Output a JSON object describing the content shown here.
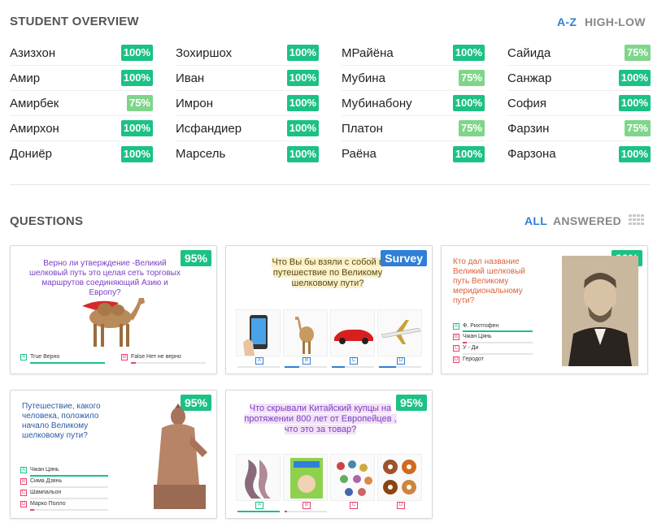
{
  "overview": {
    "title": "STUDENT OVERVIEW",
    "sort_az": "A-Z",
    "sort_highlow": "HIGH-LOW",
    "columns": [
      [
        {
          "name": "Азизхон",
          "score": "100%"
        },
        {
          "name": "Амир",
          "score": "100%"
        },
        {
          "name": "Амирбек",
          "score": "75%"
        },
        {
          "name": "Амирхон",
          "score": "100%"
        },
        {
          "name": "Дониёр",
          "score": "100%"
        }
      ],
      [
        {
          "name": "Зохиршох",
          "score": "100%"
        },
        {
          "name": "Иван",
          "score": "100%"
        },
        {
          "name": "Имрон",
          "score": "100%"
        },
        {
          "name": "Исфандиер",
          "score": "100%"
        },
        {
          "name": "Марсель",
          "score": "100%"
        }
      ],
      [
        {
          "name": "МРайёна",
          "score": "100%"
        },
        {
          "name": "Мубина",
          "score": "75%"
        },
        {
          "name": "Мубинабону",
          "score": "100%"
        },
        {
          "name": "Платон",
          "score": "75%"
        },
        {
          "name": "Раёна",
          "score": "100%"
        }
      ],
      [
        {
          "name": "Сайида",
          "score": "75%"
        },
        {
          "name": "Санжар",
          "score": "100%"
        },
        {
          "name": "София",
          "score": "100%"
        },
        {
          "name": "Фарзин",
          "score": "75%"
        },
        {
          "name": "Фарзона",
          "score": "100%"
        }
      ]
    ]
  },
  "questions": {
    "title": "QUESTIONS",
    "filter_all": "ALL",
    "filter_answered": "ANSWERED",
    "cards": [
      {
        "score": "95%",
        "text": "Верно ли утверждение -Великий шелковый путь это целая сеть торговых маршрутов соединяющий Азию и Европу?",
        "options": [
          {
            "letter": "A",
            "label": "True Верно"
          },
          {
            "letter": "B",
            "label": "False Нет не верно"
          }
        ]
      },
      {
        "score": "Survey",
        "text": "Что Вы бы взяли с собой в путешествие по Великому шелковому пути?",
        "options": [
          {
            "letter": "A"
          },
          {
            "letter": "B"
          },
          {
            "letter": "C"
          },
          {
            "letter": "D"
          }
        ]
      },
      {
        "score": "90%",
        "text": "Кто дал название Великий шелковый путь Великому меридиональному пути?",
        "options": [
          {
            "letter": "A",
            "label": "Ф. Рихтгофен"
          },
          {
            "letter": "B",
            "label": "Чжан Цянь"
          },
          {
            "letter": "C",
            "label": "У - Ди"
          },
          {
            "letter": "D",
            "label": "Геродот"
          }
        ]
      },
      {
        "score": "95%",
        "text": "Путешествие, какого человека, положило начало Великому шелковому пути?",
        "options": [
          {
            "letter": "A",
            "label": "Чжан Цянь"
          },
          {
            "letter": "B",
            "label": "Сима Дзянь"
          },
          {
            "letter": "C",
            "label": "Шампальон"
          },
          {
            "letter": "D",
            "label": "Марко Полло"
          }
        ]
      },
      {
        "score": "95%",
        "text": "Что скрывали Китайский купцы на протяжении 800 лет от Европейцев , что это за товар?",
        "options": [
          {
            "letter": "A"
          },
          {
            "letter": "B"
          },
          {
            "letter": "C"
          },
          {
            "letter": "D"
          }
        ]
      }
    ]
  },
  "colors": {
    "accent": "#2f7fd6",
    "full": "#1cc184",
    "partial": "#7fd68a",
    "wrong": "#e9436b"
  }
}
